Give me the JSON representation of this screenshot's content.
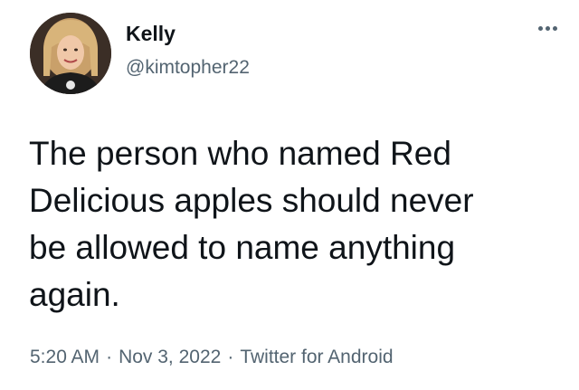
{
  "tweet": {
    "author": {
      "display_name": "Kelly",
      "handle": "@kimtopher22",
      "avatar_icon": "profile-photo-avatar"
    },
    "more_icon": "more-options-icon",
    "text": "The person who named Red\nDelicious apples should never\nbe allowed to name anything\nagain.",
    "time": "5:20 AM",
    "separator": "·",
    "date": "Nov 3, 2022",
    "source": "Twitter for Android"
  },
  "colors": {
    "text_primary": "#0f1419",
    "text_secondary": "#536471",
    "background": "#ffffff"
  }
}
